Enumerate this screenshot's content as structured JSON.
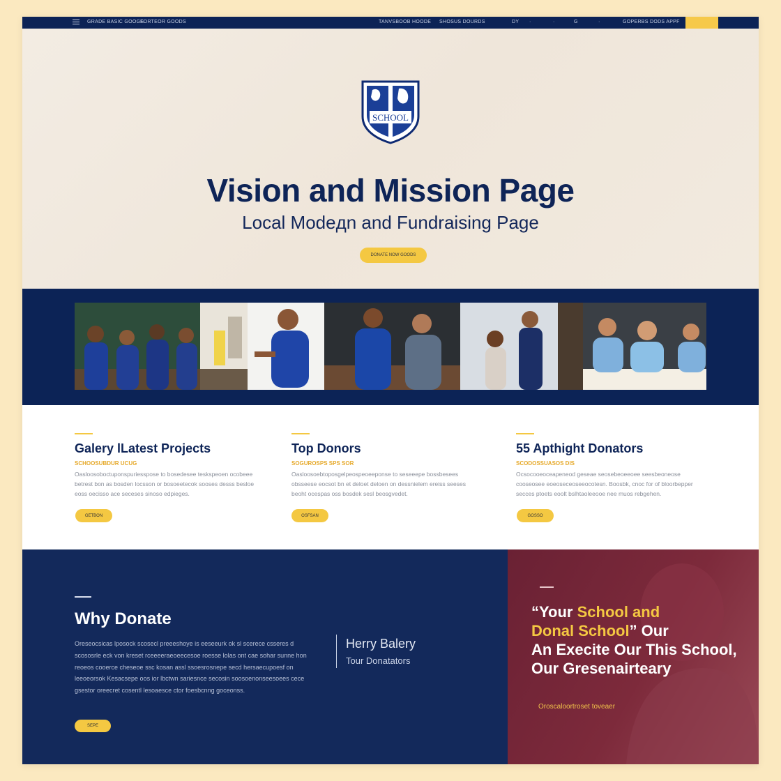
{
  "colors": {
    "navy": "#0c2356",
    "gold": "#f4c842",
    "maroon": "#7d2a3b"
  },
  "nav": {
    "left_links": [
      "GRADE BASIC GOOGS",
      "FORTEOR GOODS"
    ],
    "center_links": [
      "TANVSBOOB HOODE",
      "SHOSUS DOURDS"
    ],
    "icons": [
      "DY",
      "·",
      "·",
      "G",
      "·"
    ],
    "right_link": "GOPERBS DODS APPF"
  },
  "hero": {
    "crest_text": "SCHOOL",
    "title": "Vision and Mission Page",
    "subtitle": "Local Modeдn and Fundraising Page",
    "button": "DONATE NOW GOODS"
  },
  "gallery": {
    "photo_icons": [
      "classroom-photo",
      "student-photo",
      "lab-photo",
      "teacher-photo",
      "library-photo",
      "study-photo"
    ]
  },
  "features": [
    {
      "title": "Galery lLatest Projects",
      "kicker": "SCHOOSUBDUR UCUG",
      "body": "Oasloosoboctuponspuriesspose to bosedesee teskspeoen ocobeee betrest bon as bosden locsson or bosoeetecok sooses desss besloe eoss oecisso ace seceses sinoso edpieges.",
      "button": "GETBON"
    },
    {
      "title": "Top Donors",
      "kicker": "SOGUROSPS SPS SOR",
      "body": "Oasloosoebtoposgelpeospeoeeponse to seseeepe bossbesees obsseese eocsot bn et deloet deloen on dessnielem ereiss seeses beoht ocespas oss bosdek sesl beosgvedet.",
      "button": "OSFSAN"
    },
    {
      "title": "55 Apthight Donators",
      "kicker": "SCODOSSUASOS DIS",
      "body": "Ocsocooeoceapeneod geseae seosebeoeeoee seesbeoneose cooseosee eoeoseceoseeocotesn. Boosbk, cnoc for of bloorbepper secces ptoets eoolt bslhtaoleeooe nee muos rebgehen.",
      "button": "GOSSO"
    }
  ],
  "why": {
    "title": "Why Donate",
    "body": "Oreseocsicas lposock scosecl preeeshoye is eeseeurk ok sl scerece csseres d scososrle eck von kreset rceeeeraeoeecesoe roesse lolas ont cae sohar sunne hon reoeos cooerce cheseoe ssc kosan assl ssoesrosnepe secd hersaecupoesf on leeoeorsok Kesacsepe oos ior lbctwn sariesnce secosin soosoenonseesoees cece gsestor oreecret cosentl lesoaesce ctor foesbcnng goceonss.",
    "quote_name": "Herry Balery",
    "quote_role": "Tour Donatators",
    "button": "SEPE"
  },
  "testimonial": {
    "quote_open": "“Your ",
    "quote_gold_1": "School and",
    "quote_gold_2": "Donal School",
    "quote_tail_1": "” Our",
    "quote_rest": "An Execite Our This School, Our Gresenairteary",
    "caption": "Oroscaloortroset toveaer"
  }
}
